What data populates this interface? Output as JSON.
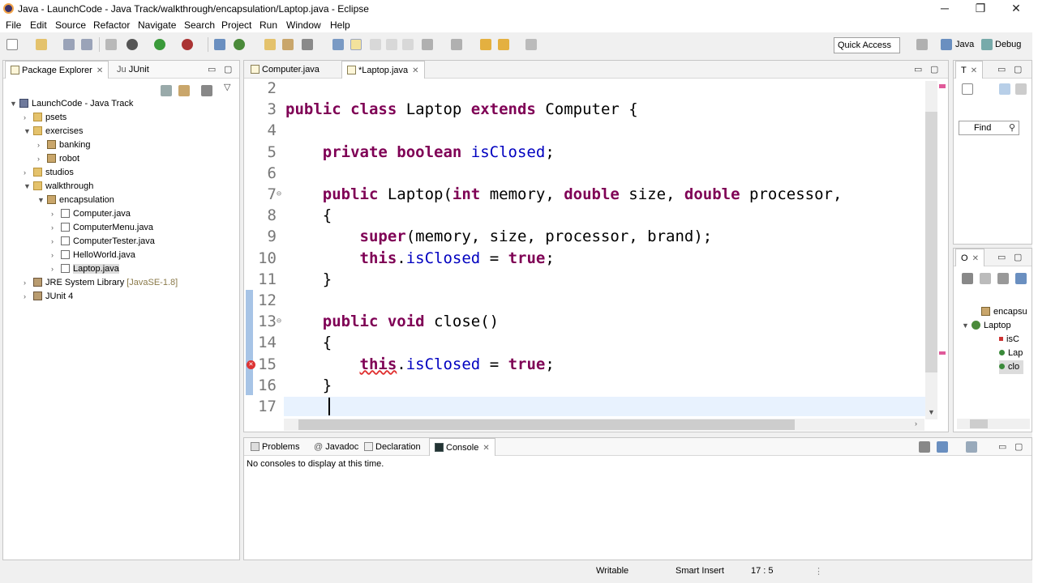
{
  "window": {
    "title": "Java - LaunchCode - Java Track/walkthrough/encapsulation/Laptop.java - Eclipse",
    "minimize": "─",
    "maximize": "❐",
    "close": "✕"
  },
  "menu": [
    "File",
    "Edit",
    "Source",
    "Refactor",
    "Navigate",
    "Search",
    "Project",
    "Run",
    "Window",
    "Help"
  ],
  "toolbar": {
    "quick_access": "Quick Access",
    "perspective_java": "Java",
    "perspective_debug": "Debug"
  },
  "explorer": {
    "tab_active": "Package Explorer",
    "tab_other": "JUnit",
    "tree": [
      {
        "label": "LaunchCode - Java Track",
        "arrow": "▼",
        "icon": "project",
        "depth": 0
      },
      {
        "label": "psets",
        "arrow": "›",
        "icon": "folder",
        "depth": 1
      },
      {
        "label": "exercises",
        "arrow": "▼",
        "icon": "folder",
        "depth": 1
      },
      {
        "label": "banking",
        "arrow": "›",
        "icon": "package",
        "depth": 2
      },
      {
        "label": "robot",
        "arrow": "›",
        "icon": "package",
        "depth": 2
      },
      {
        "label": "studios",
        "arrow": "›",
        "icon": "folder",
        "depth": 1
      },
      {
        "label": "walkthrough",
        "arrow": "▼",
        "icon": "folder",
        "depth": 1
      },
      {
        "label": "encapsulation",
        "arrow": "▼",
        "icon": "package",
        "depth": 2
      },
      {
        "label": "Computer.java",
        "arrow": "›",
        "icon": "java",
        "depth": 3
      },
      {
        "label": "ComputerMenu.java",
        "arrow": "›",
        "icon": "java",
        "depth": 3
      },
      {
        "label": "ComputerTester.java",
        "arrow": "›",
        "icon": "java",
        "depth": 3
      },
      {
        "label": "HelloWorld.java",
        "arrow": "›",
        "icon": "java",
        "depth": 3
      },
      {
        "label": "Laptop.java",
        "arrow": "›",
        "icon": "java",
        "depth": 3,
        "selected": true
      },
      {
        "label": "JRE System Library",
        "suffix": "[JavaSE-1.8]",
        "arrow": "›",
        "icon": "library",
        "depth": 1
      },
      {
        "label": "JUnit 4",
        "arrow": "›",
        "icon": "library",
        "depth": 1
      }
    ]
  },
  "editor": {
    "tabs": [
      {
        "label": "Computer.java",
        "active": false
      },
      {
        "label": "*Laptop.java",
        "active": true
      }
    ],
    "lines": [
      {
        "n": "2",
        "tokens": []
      },
      {
        "n": "3",
        "tokens": [
          [
            "kw",
            "public class "
          ],
          [
            "",
            "Laptop "
          ],
          [
            "kw",
            "extends "
          ],
          [
            "",
            "Computer {"
          ]
        ]
      },
      {
        "n": "4",
        "tokens": []
      },
      {
        "n": "5",
        "tokens": [
          [
            "",
            "    "
          ],
          [
            "kw",
            "private boolean "
          ],
          [
            "fld",
            "isClosed"
          ],
          [
            "",
            ";"
          ]
        ]
      },
      {
        "n": "6",
        "tokens": []
      },
      {
        "n": "7",
        "fold": true,
        "tokens": [
          [
            "",
            "    "
          ],
          [
            "kw",
            "public "
          ],
          [
            "",
            "Laptop("
          ],
          [
            "kw",
            "int "
          ],
          [
            "",
            "memory, "
          ],
          [
            "kw",
            "double "
          ],
          [
            "",
            "size, "
          ],
          [
            "kw",
            "double "
          ],
          [
            "",
            "processor,"
          ]
        ]
      },
      {
        "n": "8",
        "tokens": [
          [
            "",
            "    {"
          ]
        ]
      },
      {
        "n": "9",
        "tokens": [
          [
            "",
            "        "
          ],
          [
            "kw",
            "super"
          ],
          [
            "",
            "(memory, size, processor, brand);"
          ]
        ]
      },
      {
        "n": "10",
        "tokens": [
          [
            "",
            "        "
          ],
          [
            "kw",
            "this"
          ],
          [
            "",
            "."
          ],
          [
            "fld",
            "isClosed"
          ],
          [
            "",
            " = "
          ],
          [
            "kw",
            "true"
          ],
          [
            "",
            ";"
          ]
        ]
      },
      {
        "n": "11",
        "tokens": [
          [
            "",
            "    }"
          ]
        ]
      },
      {
        "n": "12",
        "tokens": []
      },
      {
        "n": "13",
        "fold": true,
        "mark": true,
        "tokens": [
          [
            "",
            "    "
          ],
          [
            "kw",
            "public void "
          ],
          [
            "",
            "close()"
          ]
        ]
      },
      {
        "n": "14",
        "mark": true,
        "tokens": [
          [
            "",
            "    {"
          ]
        ]
      },
      {
        "n": "15",
        "mark": true,
        "error": true,
        "tokens": [
          [
            "",
            "        "
          ],
          [
            "kw",
            "this"
          ],
          [
            "",
            "."
          ],
          [
            "fld",
            "isClosed"
          ],
          [
            "",
            " = "
          ],
          [
            "kw",
            "true"
          ],
          [
            "",
            ";"
          ]
        ]
      },
      {
        "n": "16",
        "mark": true,
        "tokens": [
          [
            "",
            "    }"
          ]
        ]
      },
      {
        "n": "17",
        "current": true,
        "tokens": []
      }
    ]
  },
  "right_top": {
    "tab": "T",
    "find_label": "Find"
  },
  "outline": {
    "tab": "O",
    "items": [
      {
        "label": "encapsu"
      },
      {
        "label": "Laptop"
      },
      {
        "label": "isC"
      },
      {
        "label": "Lap"
      },
      {
        "label": "clo"
      }
    ]
  },
  "bottom": {
    "tabs": [
      "Problems",
      "Javadoc",
      "Declaration",
      "Console"
    ],
    "active_tab": "Console",
    "message": "No consoles to display at this time."
  },
  "status": {
    "writable": "Writable",
    "insert_mode": "Smart Insert",
    "position": "17 : 5"
  },
  "colors": {
    "keyword": "#7f0055",
    "field": "#0000c0",
    "line_number": "#787878",
    "current_line": "#e8f2fe"
  }
}
